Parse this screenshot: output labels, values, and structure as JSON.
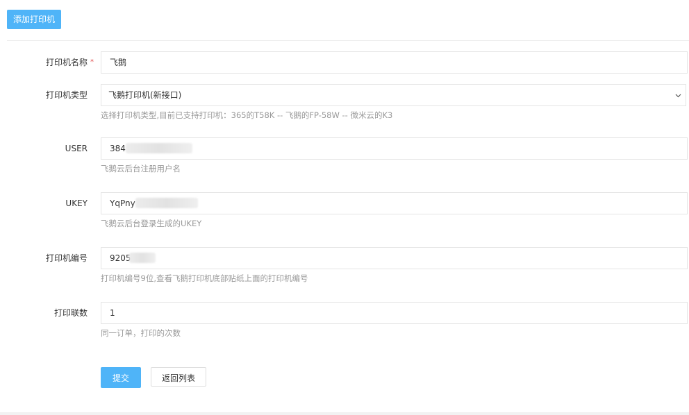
{
  "toolbar": {
    "add_printer_label": "添加打印机"
  },
  "form": {
    "name": {
      "label": "打印机名称",
      "required_mark": "*",
      "value": "飞鹅"
    },
    "type": {
      "label": "打印机类型",
      "selected": "飞鹅打印机(新接口)",
      "help": "选择打印机类型,目前已支持打印机：365的T58K -- 飞鹅的FP-58W -- 微米云的K3"
    },
    "user": {
      "label": "USER",
      "value": "384",
      "help": "飞鹅云后台注册用户名"
    },
    "ukey": {
      "label": "UKEY",
      "value": "YqPny",
      "help": "飞鹅云后台登录生成的UKEY"
    },
    "sn": {
      "label": "打印机编号",
      "value": "9205",
      "help": "打印机编号9位,查看飞鹅打印机底部贴纸上面的打印机编号"
    },
    "copies": {
      "label": "打印联数",
      "value": "1",
      "help": "同一订单，打印的次数"
    }
  },
  "actions": {
    "submit_label": "提交",
    "back_label": "返回列表"
  },
  "colors": {
    "primary": "#4fb4f8",
    "required": "#e04a4a",
    "help_text": "#999999"
  },
  "icons": {
    "select_arrow": "chevron-down-icon"
  }
}
